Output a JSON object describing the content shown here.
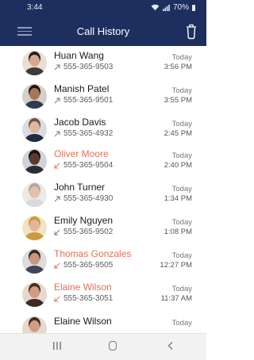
{
  "status_bar": {
    "time": "3:44",
    "battery": "70%"
  },
  "header": {
    "title": "Call History"
  },
  "calls": [
    {
      "name": "Huan Wang",
      "number": "555-365-9503",
      "date": "Today",
      "time": "3:56 PM",
      "direction": "outgoing",
      "missed": false,
      "avatar": {
        "skin": "#d7a98c",
        "hair": "#2a1c16",
        "shirt": "#3b3b3b",
        "bg": "#e8dfd6"
      }
    },
    {
      "name": "Manish Patel",
      "number": "555-365-9501",
      "date": "Today",
      "time": "3:55 PM",
      "direction": "outgoing",
      "missed": false,
      "avatar": {
        "skin": "#a8755a",
        "hair": "#1c1410",
        "shirt": "#2f3a52",
        "bg": "#d4d0c8"
      }
    },
    {
      "name": "Jacob Davis",
      "number": "555-365-4932",
      "date": "Today",
      "time": "2:45 PM",
      "direction": "outgoing",
      "missed": false,
      "avatar": {
        "skin": "#e0b79d",
        "hair": "#6b5646",
        "shirt": "#1f2a44",
        "bg": "#d9dde3"
      }
    },
    {
      "name": "Oliver Moore",
      "number": "555-365-9504",
      "date": "Today",
      "time": "2:40 PM",
      "direction": "incoming",
      "missed": true,
      "avatar": {
        "skin": "#5a3a2a",
        "hair": "#1a1210",
        "shirt": "#2c2c34",
        "bg": "#cfd4dc"
      }
    },
    {
      "name": "John Turner",
      "number": "555-365-4930",
      "date": "Today",
      "time": "1:34 PM",
      "direction": "outgoing",
      "missed": false,
      "avatar": {
        "skin": "#e3c0a8",
        "hair": "#b0a8a0",
        "shirt": "#d8dade",
        "bg": "#eceae6"
      }
    },
    {
      "name": "Emily Nguyen",
      "number": "555-365-9502",
      "date": "Today",
      "time": "1:08 PM",
      "direction": "incoming",
      "missed": false,
      "avatar": {
        "skin": "#e2b796",
        "hair": "#c99a3e",
        "shirt": "#c99a3e",
        "bg": "#f1e3c4"
      }
    },
    {
      "name": "Thomas Gonzales",
      "number": "555-365-9505",
      "date": "Today",
      "time": "12:27 PM",
      "direction": "incoming",
      "missed": true,
      "avatar": {
        "skin": "#c99878",
        "hair": "#3a2a20",
        "shirt": "#404656",
        "bg": "#dcdcdc"
      }
    },
    {
      "name": "Elaine Wilson",
      "number": "555-365-3051",
      "date": "Today",
      "time": "11:37 AM",
      "direction": "incoming",
      "missed": true,
      "avatar": {
        "skin": "#cf9e82",
        "hair": "#4a2a1c",
        "shirt": "#3c2a26",
        "bg": "#e6d8cc"
      }
    },
    {
      "name": "Elaine Wilson",
      "number": "",
      "date": "Today",
      "time": "",
      "direction": "incoming",
      "missed": false,
      "avatar": {
        "skin": "#cf9e82",
        "hair": "#4a2a1c",
        "shirt": "#3c2a26",
        "bg": "#e6d8cc"
      }
    }
  ],
  "colors": {
    "header_bg": "#1d2f5e",
    "missed": "#e1715a",
    "nav_bg": "#f2f2f2"
  }
}
